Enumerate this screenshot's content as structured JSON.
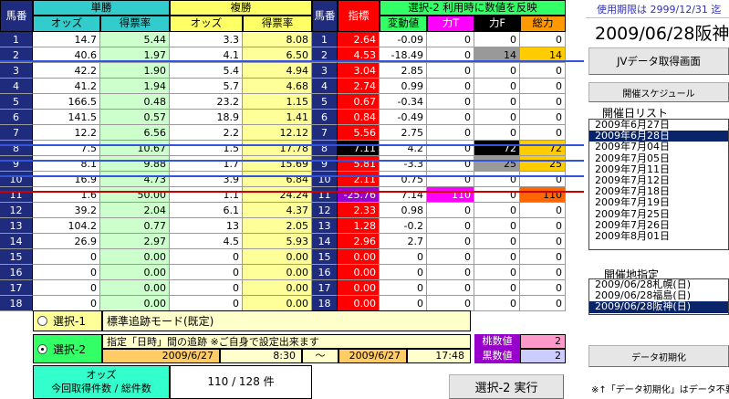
{
  "headers": {
    "umaban": "馬番",
    "tansho": "単勝",
    "fukusho": "複勝",
    "odds": "オッズ",
    "tokuhyo": "得票率",
    "umaban2": "馬番",
    "shihyo": "指標",
    "sentaku_note": "選択-2 利用時に数値を反映",
    "hendo": "変動値",
    "power_t": "力T",
    "power_f": "力F",
    "sogo": "総力"
  },
  "rows": [
    {
      "n": "1",
      "to": "14.7",
      "tr": "5.44",
      "fo": "3.3",
      "fr": "8.08",
      "n2": "1",
      "s": "2.64",
      "h": "-0.09",
      "pt": "0",
      "pf": "0",
      "so": "0"
    },
    {
      "n": "2",
      "to": "40.6",
      "tr": "1.97",
      "fo": "4.1",
      "fr": "6.50",
      "n2": "2",
      "s": "4.53",
      "h": "-18.49",
      "pt": "0",
      "pf": "14",
      "so": "14"
    },
    {
      "n": "3",
      "to": "42.2",
      "tr": "1.90",
      "fo": "5.4",
      "fr": "4.94",
      "n2": "3",
      "s": "3.04",
      "h": "2.85",
      "pt": "0",
      "pf": "0",
      "so": "0"
    },
    {
      "n": "4",
      "to": "41.2",
      "tr": "1.94",
      "fo": "5.7",
      "fr": "4.68",
      "n2": "4",
      "s": "2.74",
      "h": "0.99",
      "pt": "0",
      "pf": "0",
      "so": "0"
    },
    {
      "n": "5",
      "to": "166.5",
      "tr": "0.48",
      "fo": "23.2",
      "fr": "1.15",
      "n2": "5",
      "s": "0.67",
      "h": "-0.34",
      "pt": "0",
      "pf": "0",
      "so": "0"
    },
    {
      "n": "6",
      "to": "141.5",
      "tr": "0.57",
      "fo": "18.9",
      "fr": "1.41",
      "n2": "6",
      "s": "0.84",
      "h": "-0.49",
      "pt": "0",
      "pf": "0",
      "so": "0"
    },
    {
      "n": "7",
      "to": "12.2",
      "tr": "6.56",
      "fo": "2.2",
      "fr": "12.12",
      "n2": "7",
      "s": "5.56",
      "h": "2.75",
      "pt": "0",
      "pf": "0",
      "so": "0"
    },
    {
      "n": "8",
      "to": "7.5",
      "tr": "10.67",
      "fo": "1.5",
      "fr": "17.78",
      "n2": "8",
      "s": "7.11",
      "h": "4.2",
      "pt": "0",
      "pf": "72",
      "so": "72"
    },
    {
      "n": "9",
      "to": "8.1",
      "tr": "9.88",
      "fo": "1.7",
      "fr": "15.69",
      "n2": "9",
      "s": "5.81",
      "h": "-3.3",
      "pt": "0",
      "pf": "25",
      "so": "25"
    },
    {
      "n": "10",
      "to": "16.9",
      "tr": "4.73",
      "fo": "3.9",
      "fr": "6.84",
      "n2": "10",
      "s": "2.11",
      "h": "0.75",
      "pt": "0",
      "pf": "0",
      "so": "0"
    },
    {
      "n": "11",
      "to": "1.6",
      "tr": "50.00",
      "fo": "1.1",
      "fr": "24.24",
      "n2": "11",
      "s": "-25.76",
      "h": "7.14",
      "pt": "110",
      "pf": "0",
      "so": "110"
    },
    {
      "n": "12",
      "to": "39.2",
      "tr": "2.04",
      "fo": "6.1",
      "fr": "4.37",
      "n2": "12",
      "s": "2.33",
      "h": "0.98",
      "pt": "0",
      "pf": "0",
      "so": "0"
    },
    {
      "n": "13",
      "to": "104.2",
      "tr": "0.77",
      "fo": "13",
      "fr": "2.05",
      "n2": "13",
      "s": "1.28",
      "h": "-0.2",
      "pt": "0",
      "pf": "0",
      "so": "0"
    },
    {
      "n": "14",
      "to": "26.9",
      "tr": "2.97",
      "fo": "4.5",
      "fr": "5.93",
      "n2": "14",
      "s": "2.96",
      "h": "2.7",
      "pt": "0",
      "pf": "0",
      "so": "0"
    },
    {
      "n": "15",
      "to": "0",
      "tr": "0.00",
      "fo": "0",
      "fr": "0.00",
      "n2": "15",
      "s": "0.00",
      "h": "0",
      "pt": "0",
      "pf": "0",
      "so": "0"
    },
    {
      "n": "16",
      "to": "0",
      "tr": "0.00",
      "fo": "0",
      "fr": "0.00",
      "n2": "16",
      "s": "0.00",
      "h": "0",
      "pt": "0",
      "pf": "0",
      "so": "0"
    },
    {
      "n": "17",
      "to": "0",
      "tr": "0.00",
      "fo": "0",
      "fr": "0.00",
      "n2": "17",
      "s": "0.00",
      "h": "0",
      "pt": "0",
      "pf": "0",
      "so": "0"
    },
    {
      "n": "18",
      "to": "0",
      "tr": "0.00",
      "fo": "0",
      "fr": "0.00",
      "n2": "18",
      "s": "0.00",
      "h": "0",
      "pt": "0",
      "pf": "0",
      "so": "0"
    }
  ],
  "right": {
    "expiry": "使用期限は 2999/12/31 迄",
    "race_title": "2009/06/28阪神",
    "jv_button": "JVデータ取得画面",
    "schedule_button": "開催スケジュール",
    "date_list_label": "開催日リスト",
    "date_list": [
      "2009年6月27日",
      "2009年6月28日",
      "2009年7月04日",
      "2009年7月05日",
      "2009年7月11日",
      "2009年7月12日",
      "2009年7月18日",
      "2009年7月19日",
      "2009年7月25日",
      "2009年7月26日",
      "2009年8月01日"
    ],
    "date_selected_index": 1,
    "venue_label": "開催地指定",
    "venue_list": [
      "2009/06/28札幌(日)",
      "2009/06/28福島(日)",
      "2009/06/28阪神(日)"
    ],
    "venue_selected_index": 2,
    "init_button": "データ初期化",
    "footnote": "※↑「データ初期化」はデータ不要"
  },
  "bottom": {
    "sel1_label": "選択-1",
    "sel1_desc": "標準追跡モード(既定)",
    "sel2_label": "選択-2",
    "sel2_desc": "指定「日時」間の追跡 ※ご自身で設定出来ます",
    "date_from": "2009/6/27",
    "time_from": "8:30",
    "tilde": "〜",
    "date_to": "2009/6/27",
    "time_to": "17:48",
    "momo_label": "桃数値",
    "momo_val": "2",
    "kuro_label": "黒数値",
    "kuro_val": "2",
    "odds_label": "オッズ",
    "count_label": "今回取得件数 / 総件数",
    "count_val": "110 / 128 件",
    "run_button": "選択-2 実行"
  }
}
